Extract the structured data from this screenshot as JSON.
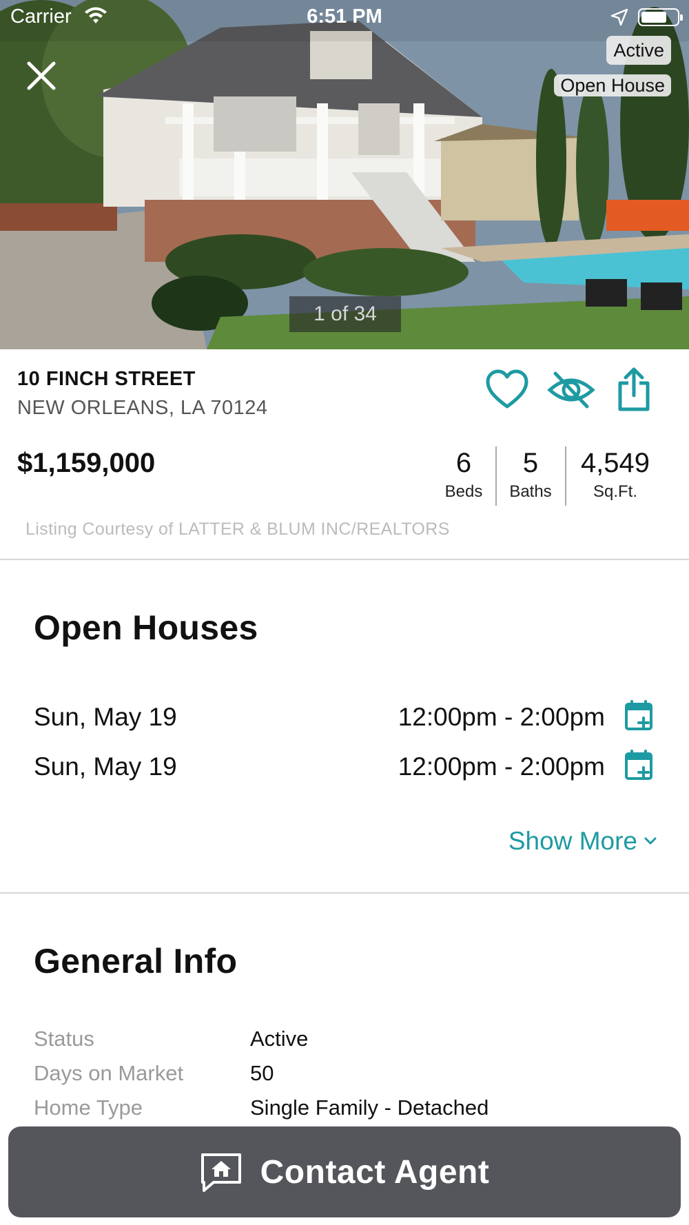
{
  "status_bar": {
    "carrier": "Carrier",
    "time": "6:51 PM"
  },
  "hero": {
    "badges": {
      "status": "Active",
      "open_house": "Open House"
    },
    "counter": "1 of 34"
  },
  "listing": {
    "street": "10 FINCH STREET",
    "city_line": "NEW ORLEANS, LA 70124",
    "price": "$1,159,000",
    "stats": {
      "beds": {
        "value": "6",
        "label": "Beds"
      },
      "baths": {
        "value": "5",
        "label": "Baths"
      },
      "sqft": {
        "value": "4,549",
        "label": "Sq.Ft."
      }
    },
    "courtesy": "Listing Courtesy of LATTER & BLUM INC/REALTORS"
  },
  "open_houses": {
    "title": "Open Houses",
    "items": [
      {
        "date": "Sun, May 19",
        "time": "12:00pm - 2:00pm"
      },
      {
        "date": "Sun, May 19",
        "time": "12:00pm - 2:00pm"
      }
    ],
    "show_more": "Show More"
  },
  "general_info": {
    "title": "General Info",
    "rows": [
      {
        "key": "Status",
        "value": "Active"
      },
      {
        "key": "Days on Market",
        "value": "50"
      },
      {
        "key": "Home Type",
        "value": "Single Family - Detached"
      }
    ]
  },
  "contact": {
    "label": "Contact Agent"
  },
  "colors": {
    "accent": "#1e9aa2",
    "button": "#54565b",
    "muted": "#9a9a9a"
  },
  "icons": [
    "close-icon",
    "heart-icon",
    "hide-eye-icon",
    "share-icon",
    "calendar-add-icon",
    "chevron-down-icon",
    "chat-home-icon",
    "wifi-icon",
    "location-arrow-icon",
    "battery-icon"
  ]
}
